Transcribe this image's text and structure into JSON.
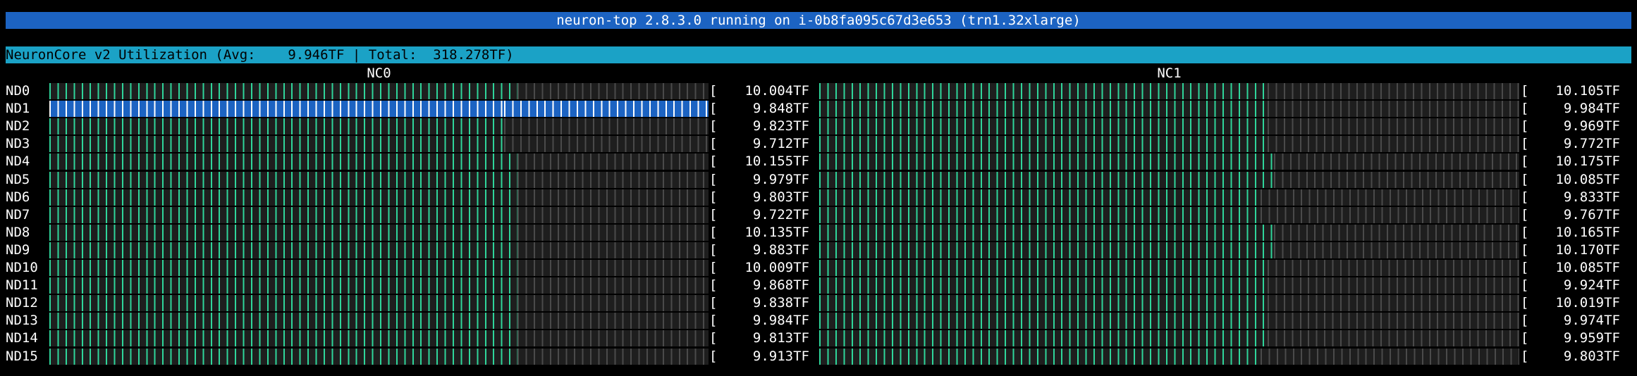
{
  "header": {
    "title": "neuron-top 2.8.3.0 running on i-0b8fa095c67d3e653 (trn1.32xlarge)"
  },
  "utilization": {
    "summary": "NeuronCore v2 Utilization (Avg:    9.946TF | Total:  318.278TF)"
  },
  "columns": [
    "NC0",
    "NC1"
  ],
  "bracket": "[",
  "selected_row": "ND1",
  "colors": {
    "title_bg": "#1c63c2",
    "summary_bg": "#1ba2c6",
    "bar_fill": "#2fd59a",
    "bar_empty": "#4a4a4a",
    "selected_bg": "#1c63c2"
  },
  "rows": [
    {
      "device": "ND0",
      "nc0": {
        "value": "10.004TF",
        "fill": 0.71
      },
      "nc1": {
        "value": "10.105TF",
        "fill": 0.64
      }
    },
    {
      "device": "ND1",
      "nc0": {
        "value": "9.848TF",
        "fill": 0.69
      },
      "nc1": {
        "value": "9.984TF",
        "fill": 0.64
      }
    },
    {
      "device": "ND2",
      "nc0": {
        "value": "9.823TF",
        "fill": 0.69
      },
      "nc1": {
        "value": "9.969TF",
        "fill": 0.64
      }
    },
    {
      "device": "ND3",
      "nc0": {
        "value": "9.712TF",
        "fill": 0.69
      },
      "nc1": {
        "value": "9.772TF",
        "fill": 0.64
      }
    },
    {
      "device": "ND4",
      "nc0": {
        "value": "10.155TF",
        "fill": 0.71
      },
      "nc1": {
        "value": "10.175TF",
        "fill": 0.65
      }
    },
    {
      "device": "ND5",
      "nc0": {
        "value": "9.979TF",
        "fill": 0.71
      },
      "nc1": {
        "value": "10.085TF",
        "fill": 0.65
      }
    },
    {
      "device": "ND6",
      "nc0": {
        "value": "9.803TF",
        "fill": 0.71
      },
      "nc1": {
        "value": "9.833TF",
        "fill": 0.63
      }
    },
    {
      "device": "ND7",
      "nc0": {
        "value": "9.722TF",
        "fill": 0.71
      },
      "nc1": {
        "value": "9.767TF",
        "fill": 0.63
      }
    },
    {
      "device": "ND8",
      "nc0": {
        "value": "10.135TF",
        "fill": 0.71
      },
      "nc1": {
        "value": "10.165TF",
        "fill": 0.65
      }
    },
    {
      "device": "ND9",
      "nc0": {
        "value": "9.883TF",
        "fill": 0.71
      },
      "nc1": {
        "value": "10.170TF",
        "fill": 0.65
      }
    },
    {
      "device": "ND10",
      "nc0": {
        "value": "10.009TF",
        "fill": 0.71
      },
      "nc1": {
        "value": "10.085TF",
        "fill": 0.64
      }
    },
    {
      "device": "ND11",
      "nc0": {
        "value": "9.868TF",
        "fill": 0.71
      },
      "nc1": {
        "value": "9.924TF",
        "fill": 0.64
      }
    },
    {
      "device": "ND12",
      "nc0": {
        "value": "9.838TF",
        "fill": 0.71
      },
      "nc1": {
        "value": "10.019TF",
        "fill": 0.64
      }
    },
    {
      "device": "ND13",
      "nc0": {
        "value": "9.984TF",
        "fill": 0.71
      },
      "nc1": {
        "value": "9.974TF",
        "fill": 0.64
      }
    },
    {
      "device": "ND14",
      "nc0": {
        "value": "9.813TF",
        "fill": 0.71
      },
      "nc1": {
        "value": "9.959TF",
        "fill": 0.64
      }
    },
    {
      "device": "ND15",
      "nc0": {
        "value": "9.913TF",
        "fill": 0.71
      },
      "nc1": {
        "value": "9.803TF",
        "fill": 0.63
      }
    }
  ]
}
